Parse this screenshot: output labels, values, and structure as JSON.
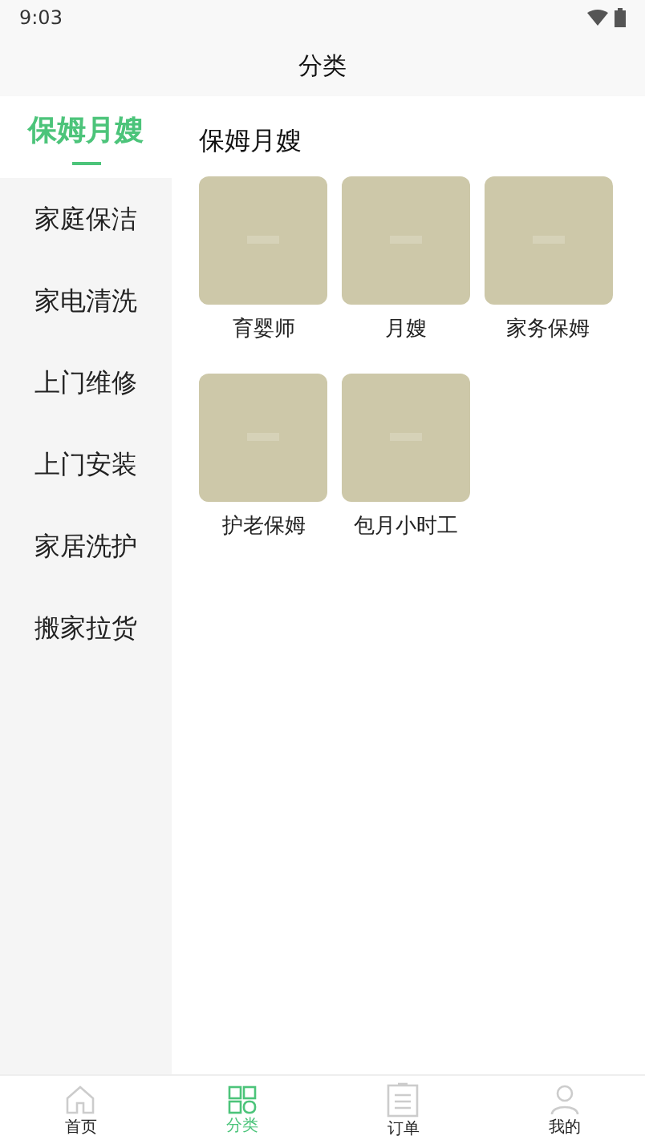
{
  "status_bar": {
    "time": "9:03"
  },
  "header": {
    "title": "分类"
  },
  "sidebar": {
    "items": [
      {
        "label": "保姆月嫂",
        "selected": true
      },
      {
        "label": "家庭保洁",
        "selected": false
      },
      {
        "label": "家电清洗",
        "selected": false
      },
      {
        "label": "上门维修",
        "selected": false
      },
      {
        "label": "上门安装",
        "selected": false
      },
      {
        "label": "家居洗护",
        "selected": false
      },
      {
        "label": "搬家拉货",
        "selected": false
      }
    ]
  },
  "content": {
    "title": "保姆月嫂",
    "items": [
      {
        "label": "育婴师",
        "kind": "picture"
      },
      {
        "label": "月嫂",
        "kind": "picture"
      },
      {
        "label": "家务保姆",
        "kind": "picture"
      },
      {
        "label": "护老保姆",
        "kind": "picture"
      },
      {
        "label": "包月小时工",
        "kind": "picture"
      }
    ]
  },
  "tab_bar": {
    "tabs": [
      {
        "label": "首页",
        "kind": "home",
        "selected": false
      },
      {
        "label": "分类",
        "kind": "grid",
        "selected": true
      },
      {
        "label": "订单",
        "kind": "order",
        "selected": false
      },
      {
        "label": "我的",
        "kind": "user",
        "selected": false
      }
    ]
  }
}
